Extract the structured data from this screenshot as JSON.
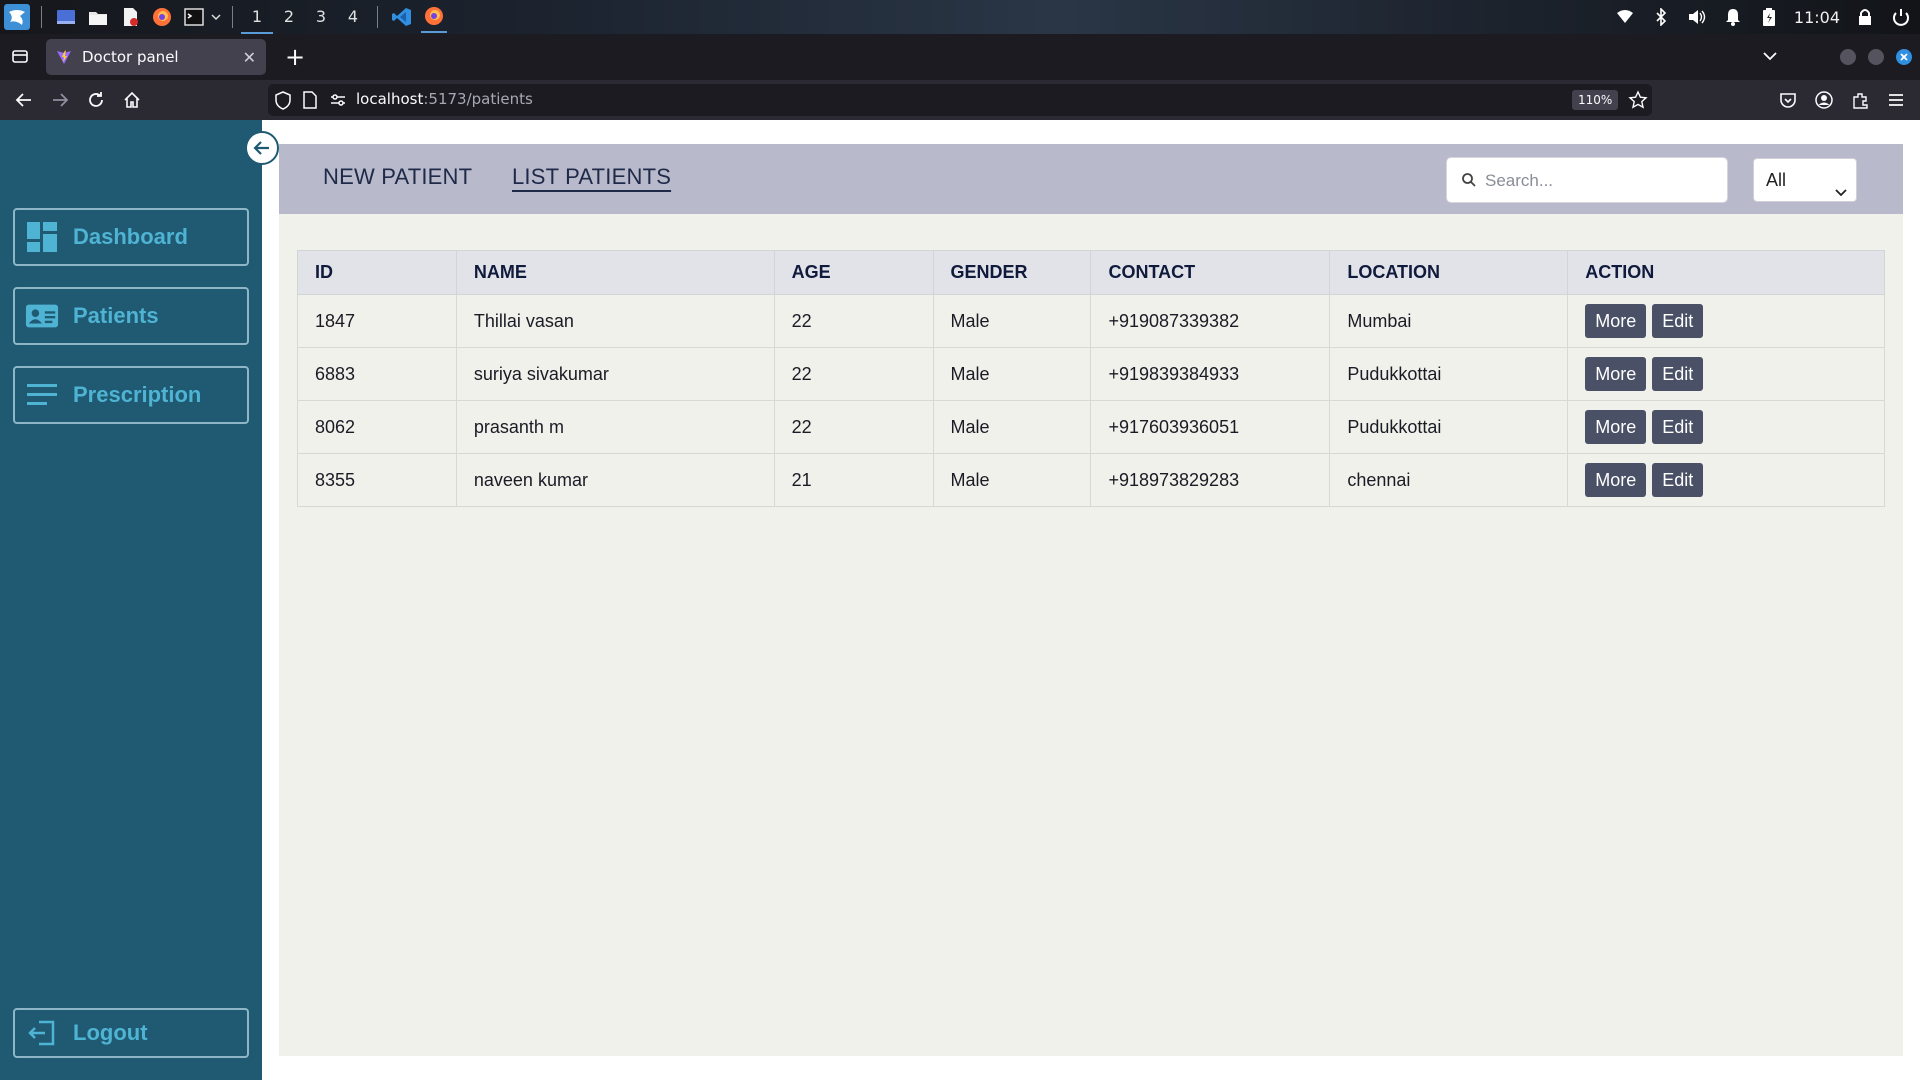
{
  "taskbar": {
    "workspaces": [
      "1",
      "2",
      "3",
      "4"
    ],
    "clock": "11:04"
  },
  "browser": {
    "tab_title": "Doctor panel",
    "url_host": "localhost",
    "url_path": ":5173/patients",
    "zoom": "110%"
  },
  "sidebar": {
    "items": [
      {
        "label": "Dashboard",
        "icon": "dashboard-icon"
      },
      {
        "label": "Patients",
        "icon": "id-card-icon"
      },
      {
        "label": "Prescription",
        "icon": "lines-icon"
      }
    ],
    "logout_label": "Logout"
  },
  "topbar": {
    "tabs": [
      "NEW PATIENT",
      "LIST PATIENTS"
    ],
    "active_tab": "LIST PATIENTS",
    "search_placeholder": "Search...",
    "filter_value": "All"
  },
  "table": {
    "headers": [
      "ID",
      "NAME",
      "AGE",
      "GENDER",
      "CONTACT",
      "LOCATION",
      "ACTION"
    ],
    "rows": [
      {
        "id": "1847",
        "name": "Thillai vasan",
        "age": "22",
        "gender": "Male",
        "contact": "+919087339382",
        "location": "Mumbai"
      },
      {
        "id": "6883",
        "name": "suriya sivakumar",
        "age": "22",
        "gender": "Male",
        "contact": "+919839384933",
        "location": "Pudukkottai"
      },
      {
        "id": "8062",
        "name": "prasanth m",
        "age": "22",
        "gender": "Male",
        "contact": "+917603936051",
        "location": "Pudukkottai"
      },
      {
        "id": "8355",
        "name": "naveen kumar",
        "age": "21",
        "gender": "Male",
        "contact": "+918973829283",
        "location": "chennai"
      }
    ],
    "more_label": "More",
    "edit_label": "Edit"
  },
  "colors": {
    "sidebar_bg": "#1f5a72",
    "sidebar_accent": "#4fb3d3",
    "topbar_bg": "#b9b9cc",
    "content_bg": "#f0f1ea",
    "action_button": "#4a5166"
  }
}
